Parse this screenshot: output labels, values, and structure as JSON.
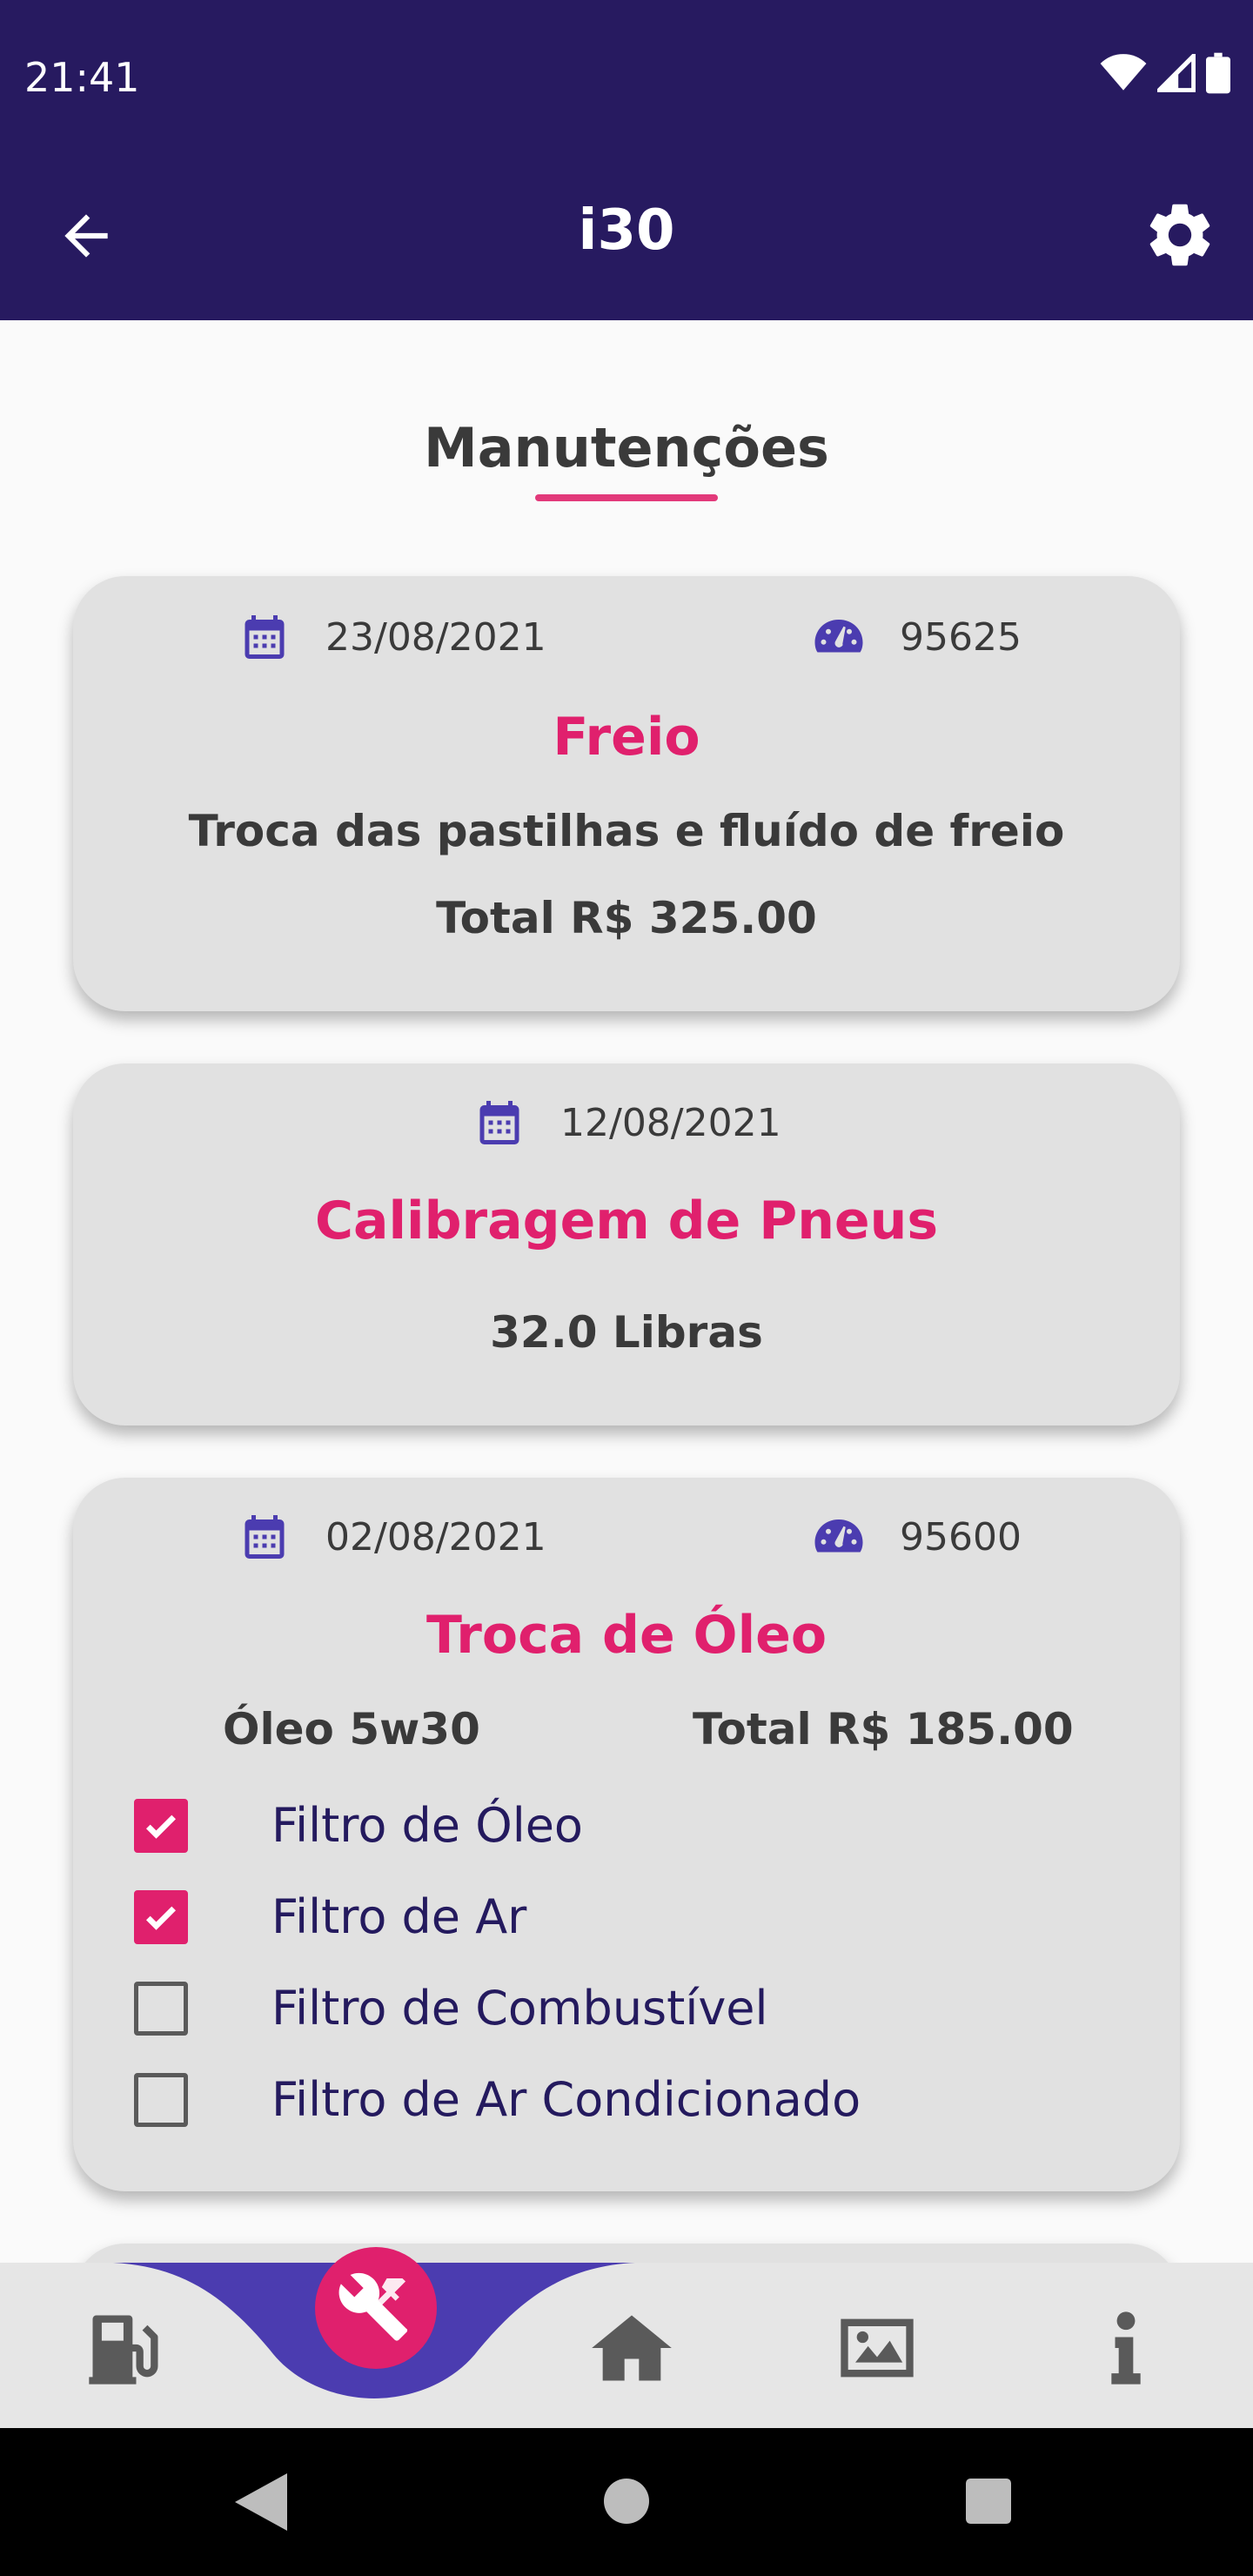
{
  "status_bar": {
    "time": "21:41"
  },
  "app_bar": {
    "title": "i30"
  },
  "section": {
    "title": "Manutenções"
  },
  "cards": [
    {
      "date": "23/08/2021",
      "km": "95625",
      "title": "Freio",
      "description": "Troca das pastilhas e fluído de freio",
      "total": "Total R$ 325.00"
    },
    {
      "date": "12/08/2021",
      "title": "Calibragem de Pneus",
      "pressure": "32.0 Libras"
    },
    {
      "date": "02/08/2021",
      "km": "95600",
      "title": "Troca de Óleo",
      "oil": "Óleo 5w30",
      "total": "Total R$ 185.00",
      "filters": [
        {
          "label": "Filtro de Óleo",
          "checked": true
        },
        {
          "label": "Filtro de Ar",
          "checked": true
        },
        {
          "label": "Filtro de Combustível",
          "checked": false
        },
        {
          "label": "Filtro de Ar Condicionado",
          "checked": false
        }
      ]
    }
  ],
  "bottom_nav": {
    "items": [
      "fuel-pump-icon",
      "tools-icon",
      "home-icon",
      "image-icon",
      "info-icon"
    ],
    "active": "tools-icon"
  },
  "colors": {
    "primary": "#271a60",
    "accent": "#e0206d",
    "icon": "#4b3cb0",
    "card": "#e1e1e1"
  }
}
